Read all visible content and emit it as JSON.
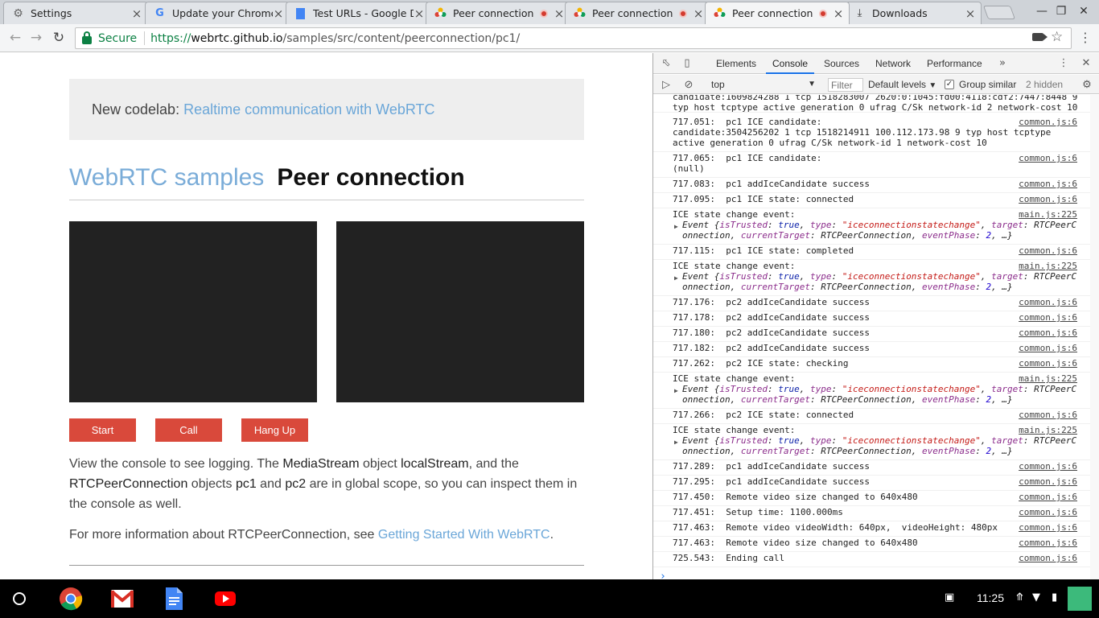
{
  "tabs": [
    {
      "title": "Settings",
      "icon": "gear-icon"
    },
    {
      "title": "Update your Chrome",
      "icon": "google-icon"
    },
    {
      "title": "Test URLs - Google Do",
      "icon": "docs-icon"
    },
    {
      "title": "Peer connection",
      "icon": "webrtc-icon",
      "recording": true
    },
    {
      "title": "Peer connection",
      "icon": "webrtc-icon",
      "recording": true
    },
    {
      "title": "Peer connection",
      "icon": "webrtc-icon",
      "recording": true,
      "active": true
    },
    {
      "title": "Downloads",
      "icon": "download-icon"
    }
  ],
  "omnibox": {
    "secure_label": "Secure",
    "url_scheme": "https://",
    "url_host": "webrtc.github.io",
    "url_path": "/samples/src/content/peerconnection/pc1/"
  },
  "page": {
    "codelab_prefix": "New codelab:",
    "codelab_link": "Realtime communication with WebRTC",
    "site_title": "WebRTC samples",
    "page_title": "Peer connection",
    "buttons": {
      "start": "Start",
      "call": "Call",
      "hangup": "Hang Up"
    },
    "desc": {
      "p1": "View the console to see logging. The ",
      "mediastream": "MediaStream",
      "p2": " object ",
      "localstream": "localStream",
      "p3": ", and the ",
      "rtcpc": "RTCPeerConnection",
      "p4": " objects ",
      "pc1": "pc1",
      "p5": " and ",
      "pc2": "pc2",
      "p6": " are in global scope, so you can inspect them in the console as well."
    },
    "more_prefix": "For more information about RTCPeerConnection, see ",
    "more_link": "Getting Started With WebRTC",
    "more_suffix": "."
  },
  "devtools": {
    "tabs": [
      "Elements",
      "Console",
      "Sources",
      "Network",
      "Performance"
    ],
    "active_tab": "Console",
    "context": "top",
    "filter_placeholder": "Filter",
    "levels": "Default levels",
    "group_similar": "Group similar",
    "hidden": "2 hidden",
    "top_partial_1": "candidate:1609824288 1 tcp 1518283007 2620:0:1045:fd00:4118:cdf2:7447:8448 9",
    "top_partial_2": "typ host tcptype active generation 0 ufrag C/Sk network-id 2 network-cost 10",
    "event_obj": {
      "head": "Event {",
      "k1": "isTrusted",
      "v1": "true",
      "k2": "type",
      "v2": "\"iceconnectionstatechange\"",
      "k3": "target",
      "v3": "RTCPeerC",
      "l2a": "onnection",
      "k4": "currentTarget",
      "v4": "RTCPeerConnection",
      "k5": "eventPhase",
      "v5": "2",
      "tail": "…}"
    },
    "logs": [
      {
        "lines": [
          "717.051:  pc1 ICE candidate:",
          "candidate:3504256202 1 tcp 1518214911 100.112.173.98 9 typ host tcptype",
          "active generation 0 ufrag C/Sk network-id 1 network-cost 10"
        ],
        "src": "common.js:6"
      },
      {
        "lines": [
          "717.065:  pc1 ICE candidate:",
          "(null)"
        ],
        "src": "common.js:6"
      },
      {
        "lines": [
          "717.083:  pc1 addIceCandidate success"
        ],
        "src": "common.js:6"
      },
      {
        "lines": [
          "717.095:  pc1 ICE state: connected"
        ],
        "src": "common.js:6"
      },
      {
        "lines": [
          "ICE state change event:"
        ],
        "src": "main.js:225",
        "event": true
      },
      {
        "lines": [
          "717.115:  pc1 ICE state: completed"
        ],
        "src": "common.js:6"
      },
      {
        "lines": [
          "ICE state change event:"
        ],
        "src": "main.js:225",
        "event": true
      },
      {
        "lines": [
          "717.176:  pc2 addIceCandidate success"
        ],
        "src": "common.js:6"
      },
      {
        "lines": [
          "717.178:  pc2 addIceCandidate success"
        ],
        "src": "common.js:6"
      },
      {
        "lines": [
          "717.180:  pc2 addIceCandidate success"
        ],
        "src": "common.js:6"
      },
      {
        "lines": [
          "717.182:  pc2 addIceCandidate success"
        ],
        "src": "common.js:6"
      },
      {
        "lines": [
          "717.262:  pc2 ICE state: checking"
        ],
        "src": "common.js:6"
      },
      {
        "lines": [
          "ICE state change event:"
        ],
        "src": "main.js:225",
        "event": true
      },
      {
        "lines": [
          "717.266:  pc2 ICE state: connected"
        ],
        "src": "common.js:6"
      },
      {
        "lines": [
          "ICE state change event:"
        ],
        "src": "main.js:225",
        "event": true
      },
      {
        "lines": [
          "717.289:  pc1 addIceCandidate success"
        ],
        "src": "common.js:6"
      },
      {
        "lines": [
          "717.295:  pc1 addIceCandidate success"
        ],
        "src": "common.js:6"
      },
      {
        "lines": [
          "717.450:  Remote video size changed to 640x480"
        ],
        "src": "common.js:6"
      },
      {
        "lines": [
          "717.451:  Setup time: 1100.000ms"
        ],
        "src": "common.js:6"
      },
      {
        "lines": [
          "717.463:  Remote video videoWidth: 640px,  videoHeight: 480px"
        ],
        "src": "common.js:6"
      },
      {
        "lines": [
          "717.463:  Remote video size changed to 640x480"
        ],
        "src": "common.js:6"
      },
      {
        "lines": [
          "725.543:  Ending call"
        ],
        "src": "common.js:6"
      }
    ]
  },
  "shelf": {
    "clock": "11:25"
  }
}
